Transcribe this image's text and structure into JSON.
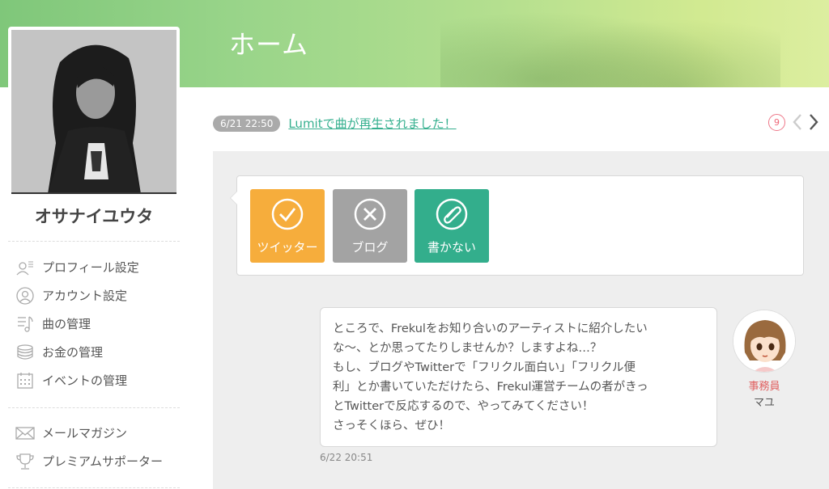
{
  "header": {
    "title": "ホーム"
  },
  "profile": {
    "name": "オサナイユウタ"
  },
  "sidebar": {
    "menu": [
      {
        "label": "プロフィール設定",
        "icon": "profile-settings-icon"
      },
      {
        "label": "アカウント設定",
        "icon": "account-icon"
      },
      {
        "label": "曲の管理",
        "icon": "music-icon"
      },
      {
        "label": "お金の管理",
        "icon": "coins-icon"
      },
      {
        "label": "イベントの管理",
        "icon": "calendar-icon"
      }
    ],
    "menu2": [
      {
        "label": "メールマガジン",
        "icon": "mail-icon"
      },
      {
        "label": "プレミアムサポーター",
        "icon": "trophy-icon"
      }
    ]
  },
  "notice": {
    "date": "6/21 22:50",
    "text": "Lumitで曲が再生されました！",
    "count": "9"
  },
  "choices": [
    {
      "label": "ツイッター",
      "icon": "check-icon",
      "color": "#f6ad3c"
    },
    {
      "label": "ブログ",
      "icon": "close-icon",
      "color": "#a3a3a3"
    },
    {
      "label": "書かない",
      "icon": "paperclip-icon",
      "color": "#33ae8c"
    }
  ],
  "message": {
    "lines": [
      "ところで、Frekulをお知り合いのアーティストに紹介したい",
      "な〜、とか思ってたりしませんか？しますよね…？",
      "もし、ブログやTwitterで「フリクル面白い」「フリクル便",
      "利」とか書いていただけたら、Frekul運営チームの者がきっ",
      "とTwitterで反応するので、やってみてください！",
      "さっそくほら、ぜひ！"
    ],
    "time": "6/22 20:51"
  },
  "staff": {
    "role": "事務員",
    "name": "マユ"
  }
}
